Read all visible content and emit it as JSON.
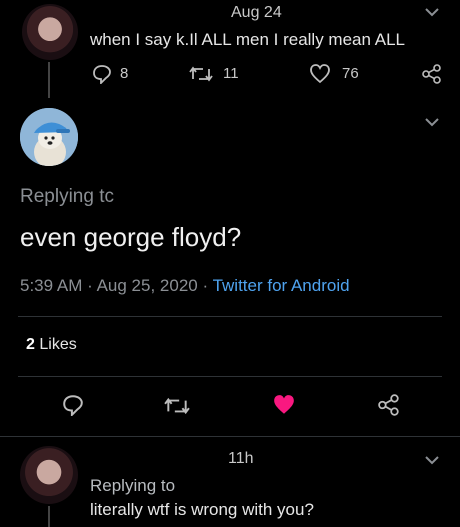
{
  "tweet1": {
    "time": "Aug 24",
    "text": "when I say k.Il ALL men I really mean ALL",
    "replies": "8",
    "retweets": "11",
    "likes": "76"
  },
  "main": {
    "replying_label": "Replying tc",
    "text": "even george floyd?",
    "time": "5:39 AM",
    "sep1": "·",
    "date": "Aug 25, 2020",
    "sep2": "·",
    "client": "Twitter for Android",
    "likes_count": "2",
    "likes_label": "Likes"
  },
  "tweet3": {
    "time": "11h",
    "replying_label": "Replying to",
    "text": "literally wtf is wrong with you?"
  },
  "colors": {
    "like_active": "#f91880",
    "link": "#4fa3ef"
  },
  "icons": [
    "chevron-down-icon",
    "reply-icon",
    "retweet-icon",
    "heart-icon",
    "share-icon"
  ]
}
